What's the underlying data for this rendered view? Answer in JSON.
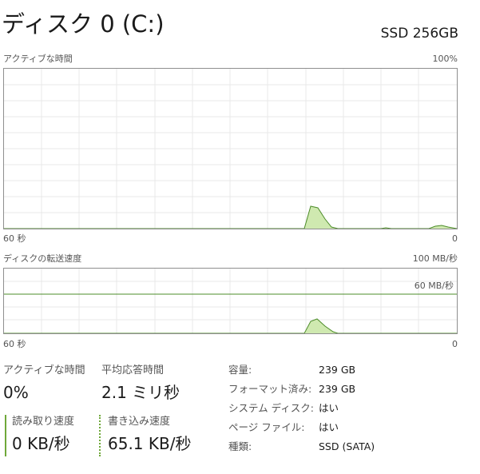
{
  "header": {
    "title": "ディスク 0 (C:)",
    "model": "SSD 256GB"
  },
  "active_time_graph": {
    "label": "アクティブな時間",
    "max_label": "100%",
    "time_label": "60 秒",
    "min_label": "0",
    "line_color": "#4d8c2a",
    "fill_color": "#cfe9b0"
  },
  "transfer_graph": {
    "label": "ディスクの転送速度",
    "max_label": "100 MB/秒",
    "ref_label": "60 MB/秒",
    "time_label": "60 秒",
    "min_label": "0",
    "line_color": "#4d8c2a",
    "fill_color": "#cfe9b0"
  },
  "stats": {
    "active_time": {
      "label": "アクティブな時間",
      "value": "0%"
    },
    "avg_response": {
      "label": "平均応答時間",
      "value": "2.1 ミリ秒"
    },
    "read_speed": {
      "label": "読み取り速度",
      "value": "0 KB/秒"
    },
    "write_speed": {
      "label": "書き込み速度",
      "value": "65.1 KB/秒"
    }
  },
  "info": [
    {
      "key": "容量:",
      "value": "239 GB"
    },
    {
      "key": "フォーマット済み:",
      "value": "239 GB"
    },
    {
      "key": "システム ディスク:",
      "value": "はい"
    },
    {
      "key": "ページ ファイル:",
      "value": "はい"
    },
    {
      "key": "種類:",
      "value": "SSD (SATA)"
    }
  ]
}
